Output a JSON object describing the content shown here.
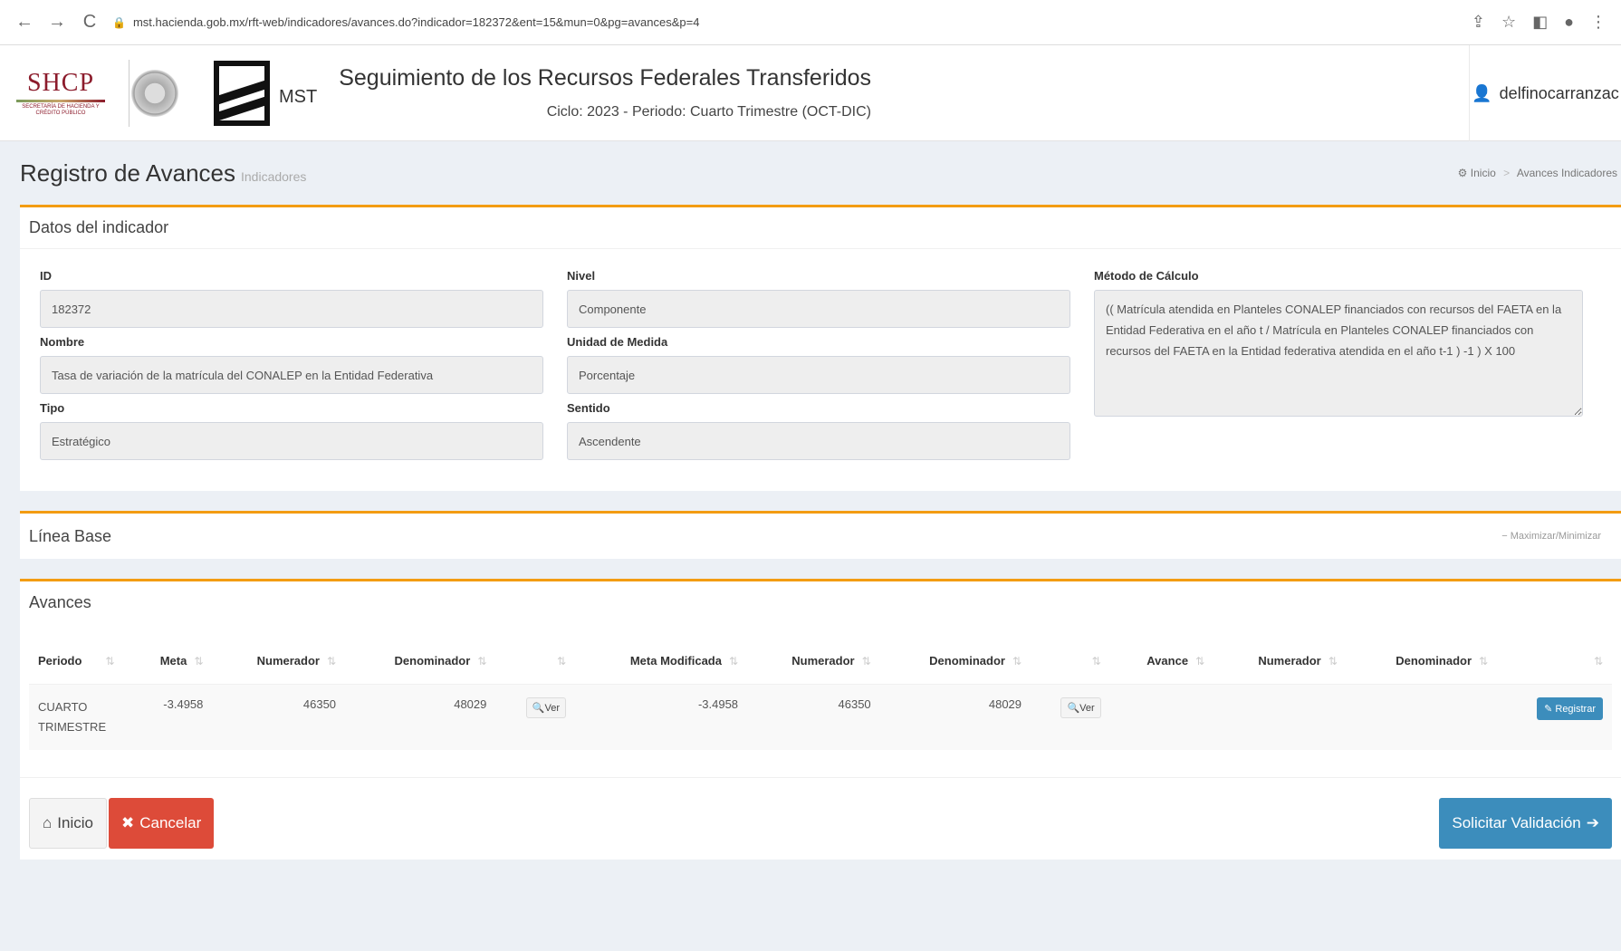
{
  "browser": {
    "url": "mst.hacienda.gob.mx/rft-web/indicadores/avances.do?indicador=182372&ent=15&mun=0&pg=avances&p=4"
  },
  "header": {
    "shcp": "SHCP",
    "shcp_sub": "SECRETARÍA DE HACIENDA Y CRÉDITO PÚBLICO",
    "mst": "MST",
    "title": "Seguimiento de los Recursos Federales Transferidos",
    "subtitle": "Ciclo: 2023 - Periodo: Cuarto Trimestre (OCT-DIC)",
    "user": "delfinocarranzac"
  },
  "page": {
    "title": "Registro de Avances",
    "subtitle": "Indicadores",
    "breadcrumb": [
      "Inicio",
      "Avances Indicadores"
    ]
  },
  "datos": {
    "title": "Datos del indicador",
    "id_label": "ID",
    "id": "182372",
    "nivel_label": "Nivel",
    "nivel": "Componente",
    "metodo_label": "Método de Cálculo",
    "metodo": "(( Matrícula atendida en Planteles CONALEP financiados con recursos del FAETA en la Entidad Federativa en el año t / Matrícula en Planteles CONALEP financiados con recursos del FAETA en la Entidad federativa atendida en el año t-1 ) -1 ) X 100",
    "nombre_label": "Nombre",
    "nombre": "Tasa de variación de la matrícula del CONALEP en la Entidad Federativa",
    "unidad_label": "Unidad de Medida",
    "unidad": "Porcentaje",
    "tipo_label": "Tipo",
    "tipo": "Estratégico",
    "sentido_label": "Sentido",
    "sentido": "Ascendente"
  },
  "linea_base": {
    "title": "Línea Base",
    "toggle": "Maximizar/Minimizar"
  },
  "avances": {
    "title": "Avances",
    "headers": [
      "Periodo",
      "Meta",
      "Numerador",
      "Denominador",
      "",
      "Meta Modificada",
      "Numerador",
      "Denominador",
      "",
      "Avance",
      "Numerador",
      "Denominador",
      ""
    ],
    "row": {
      "periodo": "CUARTO TRIMESTRE",
      "meta": "-3.4958",
      "numerador": "46350",
      "denominador": "48029",
      "ver": "Ver",
      "meta_mod": "-3.4958",
      "numerador2": "46350",
      "denominador2": "48029",
      "ver2": "Ver",
      "registrar": "Registrar"
    }
  },
  "buttons": {
    "inicio": "Inicio",
    "cancelar": "Cancelar",
    "solicitar": "Solicitar Validación"
  }
}
